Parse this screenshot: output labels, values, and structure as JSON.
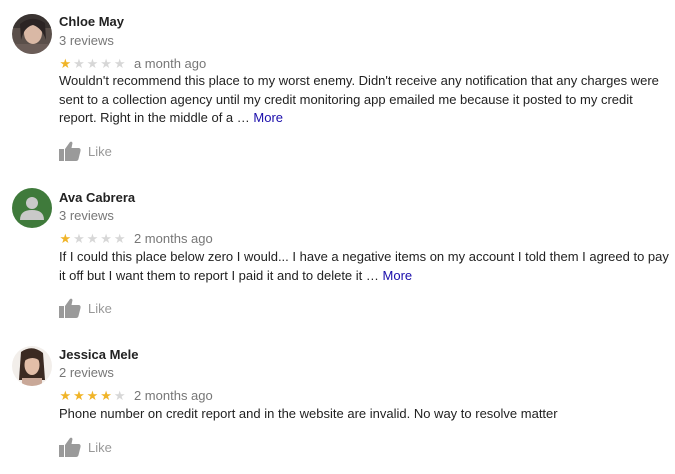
{
  "reviews": [
    {
      "name": "Chloe May",
      "review_count": "3 reviews",
      "rating": 1,
      "max_rating": 5,
      "time": "a month ago",
      "text": "Wouldn't recommend this place to my worst enemy. Didn't receive any notification that any charges were sent to a collection agency until my credit monitoring app emailed me because it posted to my credit report. Right in the middle of a …",
      "more_label": "More",
      "like_label": "Like",
      "avatar_icon": "profile-photo"
    },
    {
      "name": "Ava Cabrera",
      "review_count": "3 reviews",
      "rating": 1,
      "max_rating": 5,
      "time": "2 months ago",
      "text": "If I could this place below zero I would... I have a negative items on my account I told them I agreed to pay it off but I want them to report I paid it and to delete it …",
      "more_label": "More",
      "like_label": "Like",
      "avatar_icon": "default-person-icon"
    },
    {
      "name": "Jessica Mele",
      "review_count": "2 reviews",
      "rating": 4,
      "max_rating": 5,
      "time": "2 months ago",
      "text": "Phone number on credit report and in the website are invalid. No way to resolve matter",
      "like_label": "Like",
      "avatar_icon": "profile-photo"
    }
  ],
  "colors": {
    "star_on": "#f0b428",
    "star_off": "#d7d7d7",
    "link": "#1a0dab",
    "muted": "#777777",
    "default_avatar_bg": "#3f7a3b"
  }
}
